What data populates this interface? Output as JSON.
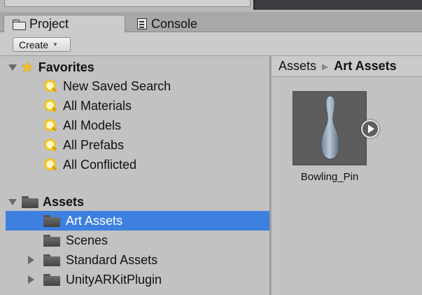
{
  "tabs": {
    "project": {
      "label": "Project",
      "icon": "folder-icon"
    },
    "console": {
      "label": "Console",
      "icon": "console-icon"
    }
  },
  "toolbar": {
    "create_label": "Create"
  },
  "favorites": {
    "label": "Favorites",
    "items": [
      {
        "label": "New Saved Search",
        "icon": "search-icon"
      },
      {
        "label": "All Materials",
        "icon": "search-icon"
      },
      {
        "label": "All Models",
        "icon": "search-icon"
      },
      {
        "label": "All Prefabs",
        "icon": "search-icon"
      },
      {
        "label": "All Conflicted",
        "icon": "search-icon"
      }
    ]
  },
  "assets": {
    "label": "Assets",
    "items": [
      {
        "label": "Art Assets",
        "selected": true,
        "expandable": false
      },
      {
        "label": "Scenes",
        "selected": false,
        "expandable": false
      },
      {
        "label": "Standard Assets",
        "selected": false,
        "expandable": true
      },
      {
        "label": "UnityARKitPlugin",
        "selected": false,
        "expandable": true
      }
    ]
  },
  "breadcrumb": {
    "root": "Assets",
    "current": "Art Assets"
  },
  "asset_grid": [
    {
      "name": "Bowling_Pin",
      "icon": "bowling-pin-thumbnail"
    }
  ],
  "colors": {
    "selection": "#3d80df",
    "favorite_star": "#f5c11a",
    "search_icon": "#f1c419"
  }
}
